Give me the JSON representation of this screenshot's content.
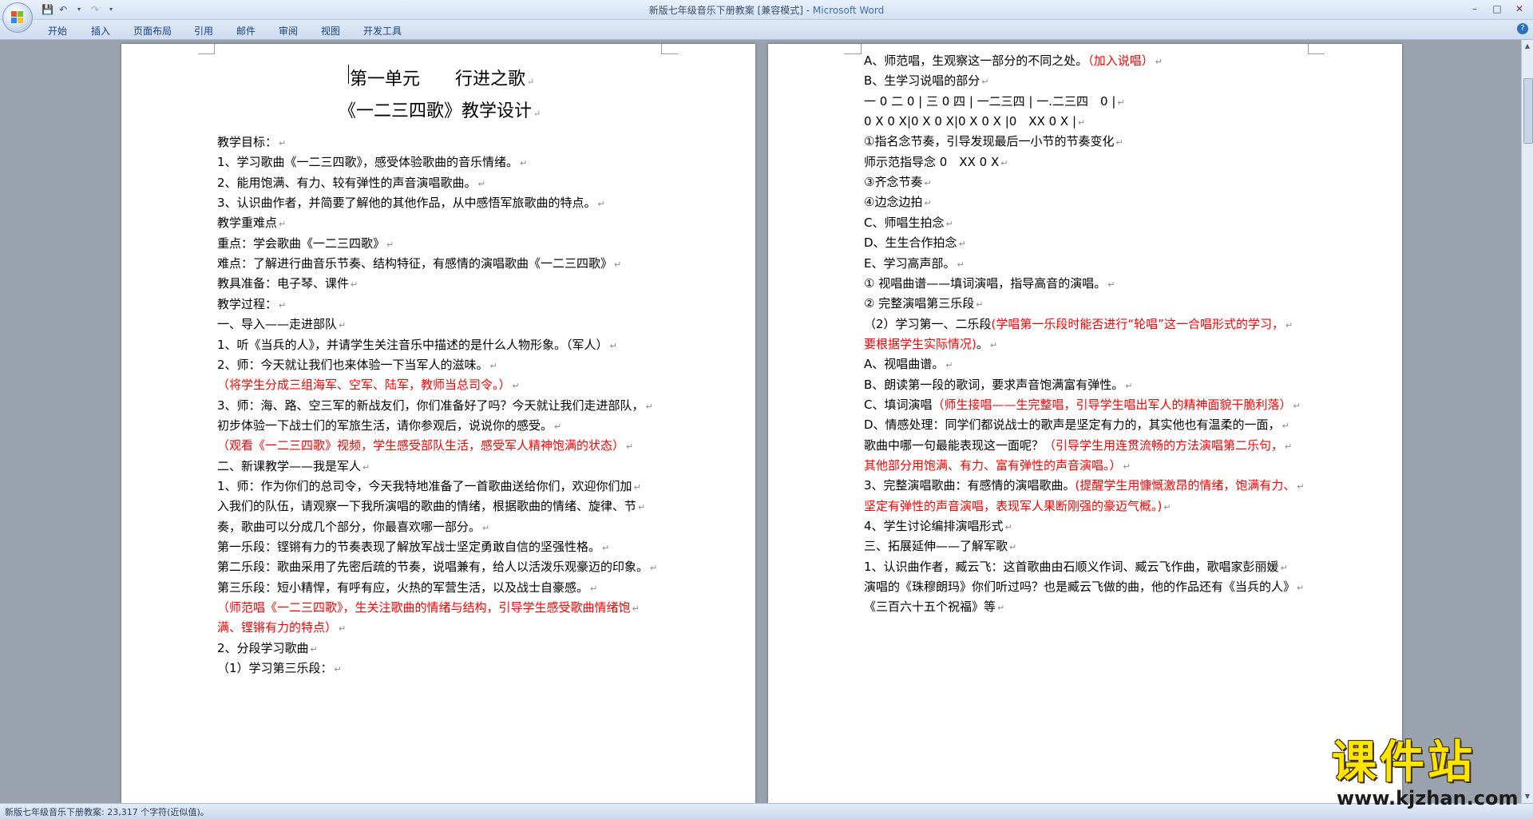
{
  "window": {
    "title_doc": "新版七年级音乐下册教案 [兼容模式] - ",
    "title_app": "Microsoft Word"
  },
  "ribbon_tabs": [
    "开始",
    "插入",
    "页面布局",
    "引用",
    "邮件",
    "审阅",
    "视图",
    "开发工具"
  ],
  "status": "新版七年级音乐下册教案: 23,317 个字符(近似值)。",
  "watermark": {
    "main": "课件站",
    "sub": "www.kjzhan.com"
  },
  "icons": {
    "office_button": "office-logo-icon",
    "save": "save-icon",
    "undo": "undo-icon",
    "redo": "redo-icon",
    "customize": "dropdown-icon",
    "minimize": "minimize-icon",
    "maximize": "maximize-icon",
    "close": "close-icon",
    "help": "help-icon"
  },
  "page1": {
    "title1": "第一单元　　行进之歌",
    "title2": "《一二三四歌》教学设计",
    "lines": [
      {
        "text": "教学目标：",
        "red": false
      },
      {
        "text": "1、学习歌曲《一二三四歌》，感受体验歌曲的音乐情绪。",
        "red": false
      },
      {
        "text": "2、能用饱满、有力、较有弹性的声音演唱歌曲。",
        "red": false
      },
      {
        "text": "3、认识曲作者，并简要了解他的其他作品，从中感悟军旅歌曲的特点。",
        "red": false
      },
      {
        "text": "教学重难点",
        "red": false
      },
      {
        "text": "重点：学会歌曲《一二三四歌》",
        "red": false
      },
      {
        "text": "难点：了解进行曲音乐节奏、结构特征，有感情的演唱歌曲《一二三四歌》",
        "red": false
      },
      {
        "text": "教具准备：电子琴、课件",
        "red": false
      },
      {
        "text": "教学过程：",
        "red": false
      },
      {
        "text": "一、导入——走进部队",
        "red": false
      },
      {
        "text": "1、听《当兵的人》，并请学生关注音乐中描述的是什么人物形象。（军人）",
        "red": false
      },
      {
        "text": "2、师：今天就让我们也来体验一下当军人的滋味。",
        "red": false
      },
      {
        "text": "（将学生分成三组海军、空军、陆军，教师当总司令。）",
        "red": true
      },
      {
        "text": "3、师：海、路、空三军的新战友们，你们准备好了吗？今天就让我们走进部队，",
        "red": false
      },
      {
        "text": "初步体验一下战士们的军旅生活，请你参观后，说说你的感受。",
        "red": false
      },
      {
        "text": "（观看《一二三四歌》视频，学生感受部队生活，感受军人精神饱满的状态）",
        "red": true
      },
      {
        "text": "二、新课教学——我是军人",
        "red": false
      },
      {
        "text": "1、师：作为你们的总司令，今天我特地准备了一首歌曲送给你们，欢迎你们加",
        "red": false
      },
      {
        "text": "入我们的队伍，请观察一下我所演唱的歌曲的情绪，根据歌曲的情绪、旋律、节",
        "red": false
      },
      {
        "text": "奏，歌曲可以分成几个部分，你最喜欢哪一部分。",
        "red": false
      },
      {
        "text": "第一乐段：铿锵有力的节奏表现了解放军战士坚定勇敢自信的坚强性格。",
        "red": false
      },
      {
        "text": "第二乐段：歌曲采用了先密后疏的节奏，说唱兼有，给人以活泼乐观豪迈的印象。",
        "red": false
      },
      {
        "text": "第三乐段：短小精悍，有呼有应，火热的军营生活，以及战士自豪感。",
        "red": false
      },
      {
        "text": "（师范唱《一二三四歌》，生关注歌曲的情绪与结构，引导学生感受歌曲情绪饱",
        "red": true
      },
      {
        "text": "满、铿锵有力的特点）",
        "red": true
      },
      {
        "text": "2、分段学习歌曲",
        "red": false
      },
      {
        "text": "（1）学习第三乐段：",
        "red": false
      }
    ]
  },
  "page2": {
    "lines": [
      {
        "parts": [
          {
            "t": "A、师范唱，生观察这一部分的不同之处。",
            "red": false
          },
          {
            "t": "（加入说唱）",
            "red": true
          }
        ]
      },
      {
        "parts": [
          {
            "t": "B、生学习说唱的部分",
            "red": false
          }
        ]
      },
      {
        "parts": [
          {
            "t": "一 0 二 0 | 三 0 四 | 一二三四 | 一.二三四　0 |",
            "red": false
          }
        ]
      },
      {
        "parts": [
          {
            "t": "0 X 0 X|0 X 0 X|0 X 0 X |0　XX 0 X |",
            "red": false
          }
        ]
      },
      {
        "parts": [
          {
            "t": "①指名念节奏，引导发现最后一小节的节奏变化",
            "red": false
          }
        ]
      },
      {
        "parts": [
          {
            "t": "师示范指导念 0　XX 0 X",
            "red": false
          }
        ]
      },
      {
        "parts": [
          {
            "t": "③齐念节奏",
            "red": false
          }
        ]
      },
      {
        "parts": [
          {
            "t": "④边念边拍",
            "red": false
          }
        ]
      },
      {
        "parts": [
          {
            "t": "C、师唱生拍念",
            "red": false
          }
        ]
      },
      {
        "parts": [
          {
            "t": "D、生生合作拍念",
            "red": false
          }
        ]
      },
      {
        "parts": [
          {
            "t": "E、学习高声部。",
            "red": false
          }
        ]
      },
      {
        "parts": [
          {
            "t": "① 视唱曲谱——填词演唱，指导高音的演唱。",
            "red": false
          }
        ]
      },
      {
        "parts": [
          {
            "t": "② 完整演唱第三乐段",
            "red": false
          }
        ]
      },
      {
        "parts": [
          {
            "t": "（2）学习第一、二乐段",
            "red": false
          },
          {
            "t": "(学唱第一乐段时能否进行“轮唱”这一合唱形式的学习，",
            "red": true
          }
        ]
      },
      {
        "parts": [
          {
            "t": "要根据学生实际情况)",
            "red": true
          },
          {
            "t": "。",
            "red": false
          }
        ]
      },
      {
        "parts": [
          {
            "t": "A、视唱曲谱。",
            "red": false
          }
        ]
      },
      {
        "parts": [
          {
            "t": "B、朗读第一段的歌词，要求声音饱满富有弹性。",
            "red": false
          }
        ]
      },
      {
        "parts": [
          {
            "t": "C、填词演唱",
            "red": false
          },
          {
            "t": "（师生接唱——生完整唱，引导学生唱出军人的精神面貌干脆利落）",
            "red": true
          }
        ]
      },
      {
        "parts": [
          {
            "t": "D、情感处理：同学们都说战士的歌声是坚定有力的，其实他也有温柔的一面，",
            "red": false
          }
        ]
      },
      {
        "parts": [
          {
            "t": "歌曲中哪一句最能表现这一面呢？",
            "red": false
          },
          {
            "t": "（引导学生用连贯流畅的方法演唱第二乐句，",
            "red": true
          }
        ]
      },
      {
        "parts": [
          {
            "t": "其他部分用饱满、有力、富有弹性的声音演唱。）",
            "red": true
          }
        ]
      },
      {
        "parts": [
          {
            "t": "3、完整演唱歌曲：有感情的演唱歌曲。",
            "red": false
          },
          {
            "t": "(提醒学生用慷慨激昂的情绪，饱满有力、",
            "red": true
          }
        ]
      },
      {
        "parts": [
          {
            "t": "坚定有弹性的声音演唱，表现军人果断刚强的豪迈气概。)",
            "red": true
          }
        ]
      },
      {
        "parts": [
          {
            "t": "4、学生讨论编排演唱形式",
            "red": false
          }
        ]
      },
      {
        "parts": [
          {
            "t": "三、拓展延伸——了解军歌",
            "red": false
          }
        ]
      },
      {
        "parts": [
          {
            "t": "1、认识曲作者，臧云飞：这首歌曲由石顺义作词、臧云飞作曲，歌唱家彭丽媛",
            "red": false
          }
        ]
      },
      {
        "parts": [
          {
            "t": "演唱的《珠穆朗玛》你们听过吗？也是臧云飞做的曲，他的作品还有《当兵的人》",
            "red": false
          }
        ]
      },
      {
        "parts": [
          {
            "t": "《三百六十五个祝福》等",
            "red": false
          }
        ]
      }
    ]
  }
}
